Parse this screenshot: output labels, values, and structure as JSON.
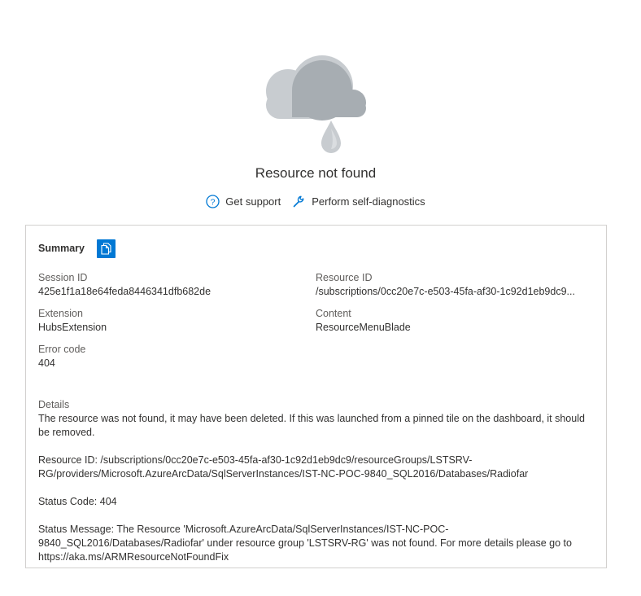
{
  "error": {
    "title": "Resource not found",
    "illustration": "cloud-rain-icon"
  },
  "actions": {
    "get_support": "Get support",
    "self_diagnostics": "Perform self-diagnostics"
  },
  "summary": {
    "title": "Summary",
    "fields": {
      "session_id": {
        "label": "Session ID",
        "value": "425e1f1a18e64feda8446341dfb682de"
      },
      "resource_id": {
        "label": "Resource ID",
        "value": "/subscriptions/0cc20e7c-e503-45fa-af30-1c92d1eb9dc9..."
      },
      "extension": {
        "label": "Extension",
        "value": "HubsExtension"
      },
      "content": {
        "label": "Content",
        "value": "ResourceMenuBlade"
      },
      "error_code": {
        "label": "Error code",
        "value": "404"
      }
    },
    "details": {
      "label": "Details",
      "message": "The resource was not found, it may have been deleted. If this was launched from a pinned tile on the dashboard, it should be removed.",
      "resource_id_line": "Resource ID: /subscriptions/0cc20e7c-e503-45fa-af30-1c92d1eb9dc9/resourceGroups/LSTSRV-RG/providers/Microsoft.AzureArcData/SqlServerInstances/IST-NC-POC-9840_SQL2016/Databases/Radiofar",
      "status_code_line": "Status Code: 404",
      "status_message_line": "Status Message: The Resource 'Microsoft.AzureArcData/SqlServerInstances/IST-NC-POC-9840_SQL2016/Databases/Radiofar' under resource group 'LSTSRV-RG' was not found. For more details please go to https://aka.ms/ARMResourceNotFoundFix"
    }
  },
  "colors": {
    "accent": "#0078d4",
    "border": "#d2d0ce",
    "cloud_light": "#c8ccd0",
    "cloud_dark": "#a3a9ae"
  }
}
